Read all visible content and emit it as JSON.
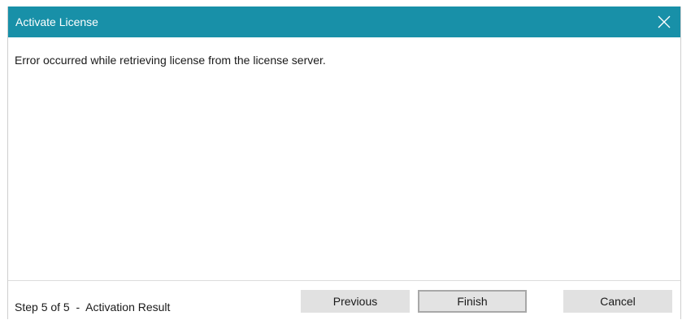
{
  "window": {
    "title": "Activate License",
    "close_icon": "close-icon",
    "titlebar_color": "#1890a8"
  },
  "main": {
    "message": "Error occurred while retrieving license from the license server."
  },
  "footer": {
    "step_text": "Step 5 of 5  -  Activation Result",
    "buttons": {
      "previous": "Previous",
      "finish": "Finish",
      "cancel": "Cancel"
    }
  }
}
